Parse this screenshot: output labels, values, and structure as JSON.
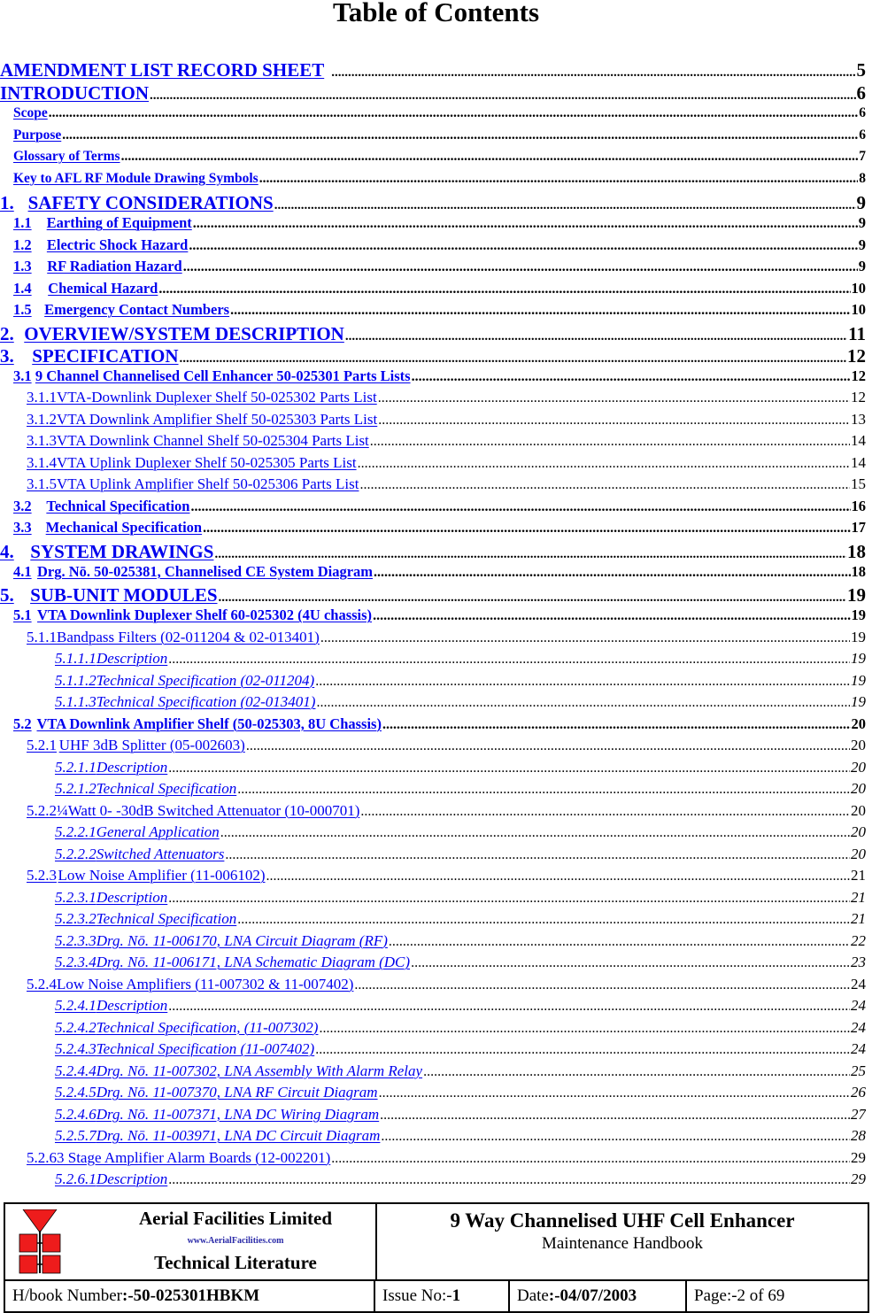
{
  "title": "Table of Contents",
  "toc": [
    {
      "level": "l0",
      "num": "",
      "label": "AMENDMENT LIST RECORD SHEET",
      "page": "5",
      "leader_space": true
    },
    {
      "level": "l0",
      "num": "",
      "label": "INTRODUCTION",
      "page": "6"
    },
    {
      "level": "lf",
      "num": "",
      "label": "Scope",
      "page": "6"
    },
    {
      "level": "lf",
      "num": "",
      "label": "Purpose",
      "page": "6"
    },
    {
      "level": "lf",
      "num": "",
      "label": "Glossary of Terms",
      "page": "7"
    },
    {
      "level": "lf",
      "num": "",
      "label": "Key to AFL RF Module Drawing Symbols",
      "page": "8"
    },
    {
      "level": "l1",
      "num": "1.",
      "label": "SAFETY CONSIDERATIONS",
      "page": "9"
    },
    {
      "level": "l2",
      "num": "1.1",
      "label": "Earthing of Equipment",
      "page": "9"
    },
    {
      "level": "l2",
      "num": "1.2",
      "label": "Electric Shock Hazard",
      "page": "9"
    },
    {
      "level": "l2",
      "num": "1.3",
      "label": "RF Radiation Hazard",
      "page": "9"
    },
    {
      "level": "l2",
      "num": "1.4",
      "label": "Chemical Hazard",
      "page": "10"
    },
    {
      "level": "l2",
      "num": "1.5",
      "label": "Emergency Contact Numbers",
      "page": "10"
    },
    {
      "level": "l1",
      "num": "2.",
      "label": "OVERVIEW/SYSTEM DESCRIPTION",
      "page": "11"
    },
    {
      "level": "l1",
      "num": "3.",
      "label": "SPECIFICATION",
      "page": "12"
    },
    {
      "level": "l2",
      "num": "3.1",
      "label": "9 Channel Channelised Cell Enhancer 50-025301 Parts Lists",
      "page": "12"
    },
    {
      "level": "l3",
      "num": "3.1.1",
      "label": "VTA-Downlink Duplexer Shelf 50-025302 Parts List",
      "page": "12"
    },
    {
      "level": "l3",
      "num": "3.1.2",
      "label": "VTA Downlink Amplifier Shelf 50-025303 Parts List",
      "page": "13"
    },
    {
      "level": "l3",
      "num": "3.1.3",
      "label": "VTA Downlink Channel Shelf 50-025304 Parts List",
      "page": "14"
    },
    {
      "level": "l3",
      "num": "3.1.4",
      "label": "VTA Uplink Duplexer Shelf 50-025305 Parts List",
      "page": "14"
    },
    {
      "level": "l3",
      "num": "3.1.5",
      "label": "VTA Uplink Amplifier Shelf 50-025306 Parts List",
      "page": "15"
    },
    {
      "level": "l2",
      "num": "3.2",
      "label": "Technical Specification",
      "page": "16"
    },
    {
      "level": "l2",
      "num": "3.3",
      "label": "Mechanical Specification",
      "page": "17"
    },
    {
      "level": "l1",
      "num": "4.",
      "label": "SYSTEM DRAWINGS",
      "page": "18"
    },
    {
      "level": "l2",
      "num": "4.1",
      "label": "Drg. Nō. 50-025381, Channelised CE System Diagram",
      "page": "18"
    },
    {
      "level": "l1",
      "num": "5.",
      "label": "SUB-UNIT MODULES",
      "page": "19"
    },
    {
      "level": "l2",
      "num": "5.1",
      "label": "VTA Downlink Duplexer Shelf 60-025302 (4U chassis)",
      "page": "19"
    },
    {
      "level": "l3",
      "num": "5.1.1",
      "label": "Bandpass Filters (02-011204 & 02-013401)",
      "page": "19"
    },
    {
      "level": "l4",
      "num": "5.1.1.1",
      "label": "Description",
      "page": "19"
    },
    {
      "level": "l4",
      "num": "5.1.1.2",
      "label": "Technical Specification (02-011204)",
      "page": "19"
    },
    {
      "level": "l4",
      "num": "5.1.1.3",
      "label": "Technical Specification (02-013401)",
      "page": "19"
    },
    {
      "level": "l2",
      "num": "5.2",
      "label": "VTA Downlink Amplifier Shelf (50-025303, 8U Chassis)",
      "page": "20"
    },
    {
      "level": "l3",
      "num": "5.2.1",
      "label": "UHF 3dB Splitter (05-002603)",
      "page": "20"
    },
    {
      "level": "l4",
      "num": "5.2.1.1",
      "label": "Description",
      "page": "20"
    },
    {
      "level": "l4",
      "num": "5.2.1.2",
      "label": "Technical Specification",
      "page": "20"
    },
    {
      "level": "l3",
      "num": "5.2.2",
      "label": "¼Watt 0- -30dB Switched Attenuator (10-000701)",
      "page": "20"
    },
    {
      "level": "l4",
      "num": "5.2.2.1",
      "label": "General Application",
      "page": "20"
    },
    {
      "level": "l4",
      "num": "5.2.2.2",
      "label": "Switched Attenuators",
      "page": "20"
    },
    {
      "level": "l3",
      "num": "5.2.3",
      "label": "Low Noise Amplifier (11-006102)",
      "page": "21"
    },
    {
      "level": "l4",
      "num": "5.2.3.1",
      "label": "Description",
      "page": "21"
    },
    {
      "level": "l4",
      "num": "5.2.3.2",
      "label": "Technical Specification",
      "page": "21"
    },
    {
      "level": "l4",
      "num": "5.2.3.3",
      "label": "Drg. Nō. 11-006170, LNA Circuit Diagram (RF)",
      "page": "22"
    },
    {
      "level": "l4",
      "num": "5.2.3.4",
      "label": "Drg. Nō. 11-006171, LNA Schematic Diagram (DC)",
      "page": "23"
    },
    {
      "level": "l3",
      "num": "5.2.4",
      "label": "Low Noise Amplifiers (11-007302 & 11-007402)",
      "page": "24"
    },
    {
      "level": "l4",
      "num": "5.2.4.1",
      "label": "Description",
      "page": "24"
    },
    {
      "level": "l4",
      "num": "5.2.4.2",
      "label": "Technical Specification, (11-007302)",
      "page": "24"
    },
    {
      "level": "l4",
      "num": "5.2.4.3",
      "label": "Technical Specification (11-007402)",
      "page": "24"
    },
    {
      "level": "l4",
      "num": "5.2.4.4",
      "label": "Drg. Nō. 11-007302, LNA Assembly With Alarm Relay",
      "page": "25"
    },
    {
      "level": "l4",
      "num": "5.2.4.5",
      "label": "Drg. Nō. 11-007370, LNA RF Circuit Diagram",
      "page": "26"
    },
    {
      "level": "l4",
      "num": "5.2.4.6",
      "label": "Drg. Nō. 11-007371, LNA DC Wiring Diagram",
      "page": "27"
    },
    {
      "level": "l4",
      "num": "5.2.5.7",
      "label": "Drg. Nō. 11-003971, LNA DC Circuit Diagram",
      "page": "28"
    },
    {
      "level": "l3",
      "num": "5.2.6",
      "label": "3 Stage Amplifier Alarm Boards (12-002201)",
      "page": "29"
    },
    {
      "level": "l4",
      "num": "5.2.6.1",
      "label": "Description",
      "page": "29"
    }
  ],
  "footer": {
    "company_name": "Aerial  Facilities  Limited",
    "company_url": "www.AerialFacilities.com",
    "company_tagline": "Technical Literature",
    "logo_icon": "afl-logo-icon",
    "logo_color": "#ee1c1c",
    "product_title": "9 Way Channelised UHF Cell Enhancer",
    "product_subtitle": "Maintenance Handbook",
    "handbook_label": "H/book Number",
    "handbook_value": ":-50-025301HBKM",
    "issue_label": "Issue No:-",
    "issue_value": "1",
    "date_label": "Date",
    "date_value": ":-04/07/2003",
    "page_label": "Page",
    "page_value": ":-2 of 69"
  },
  "link_color": "#0000ee"
}
